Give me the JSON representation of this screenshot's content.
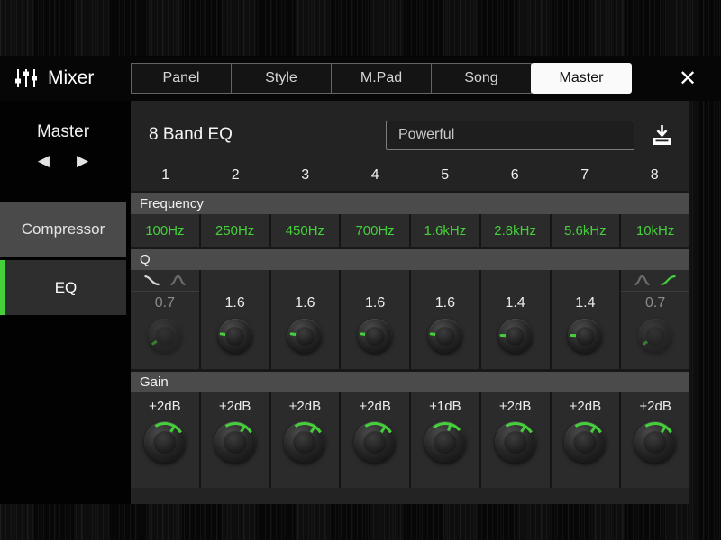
{
  "header": {
    "title": "Mixer",
    "tabs": [
      "Panel",
      "Style",
      "M.Pad",
      "Song",
      "Master"
    ],
    "active_tab": "Master",
    "close_glyph": "✕"
  },
  "sidebar": {
    "label": "Master",
    "prev_glyph": "◀",
    "next_glyph": "▶",
    "items": [
      "Compressor",
      "EQ"
    ],
    "active_item": "EQ"
  },
  "eq": {
    "title": "8 Band EQ",
    "preset": "Powerful",
    "bands": [
      "1",
      "2",
      "3",
      "4",
      "5",
      "6",
      "7",
      "8"
    ],
    "sections": {
      "frequency": "Frequency",
      "q": "Q",
      "gain": "Gain"
    },
    "frequencies": [
      "100Hz",
      "250Hz",
      "450Hz",
      "700Hz",
      "1.6kHz",
      "2.8kHz",
      "5.6kHz",
      "10kHz"
    ],
    "q_values": [
      "0.7",
      "1.6",
      "1.6",
      "1.6",
      "1.6",
      "1.4",
      "1.4",
      "0.7"
    ],
    "q_disabled_bands": [
      "1",
      "8"
    ],
    "gain_values": [
      "+2dB",
      "+2dB",
      "+2dB",
      "+2dB",
      "+1dB",
      "+2dB",
      "+2dB",
      "+2dB"
    ]
  },
  "colors": {
    "accent_green": "#45cf3b"
  }
}
